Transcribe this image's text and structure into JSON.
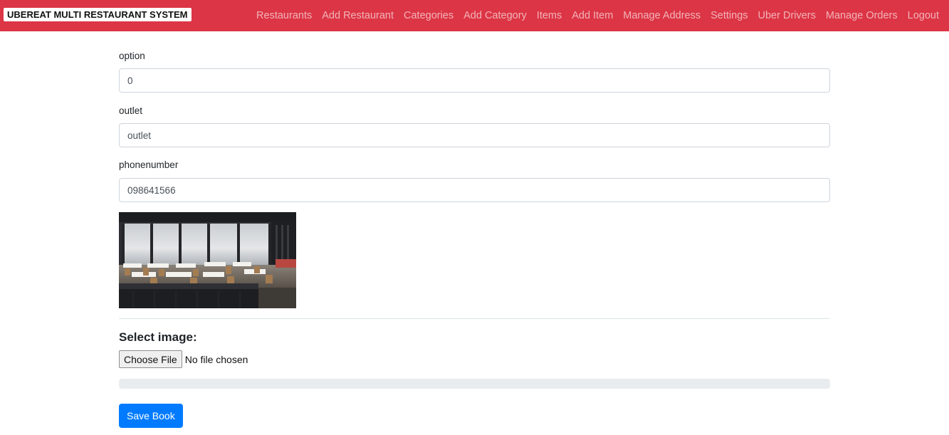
{
  "brand": "UBEREAT MULTI RESTAURANT SYSTEM",
  "nav": [
    "Restaurants",
    "Add Restaurant",
    "Categories",
    "Add Category",
    "Items",
    "Add Item",
    "Manage Address",
    "Settings",
    "Uber Drivers",
    "Manage Orders",
    "Logout"
  ],
  "form": {
    "option": {
      "label": "option",
      "value": "0"
    },
    "outlet": {
      "label": "outlet",
      "value": "outlet"
    },
    "phonenumber": {
      "label": "phonenumber",
      "value": "098641566"
    }
  },
  "image_section": {
    "title": "Select image:",
    "choose_label": "Choose File",
    "file_status": "No file chosen"
  },
  "upload_progress": 0,
  "save_label": "Save Book",
  "colors": {
    "navbar": "#dc3545",
    "primary": "#007bff"
  }
}
